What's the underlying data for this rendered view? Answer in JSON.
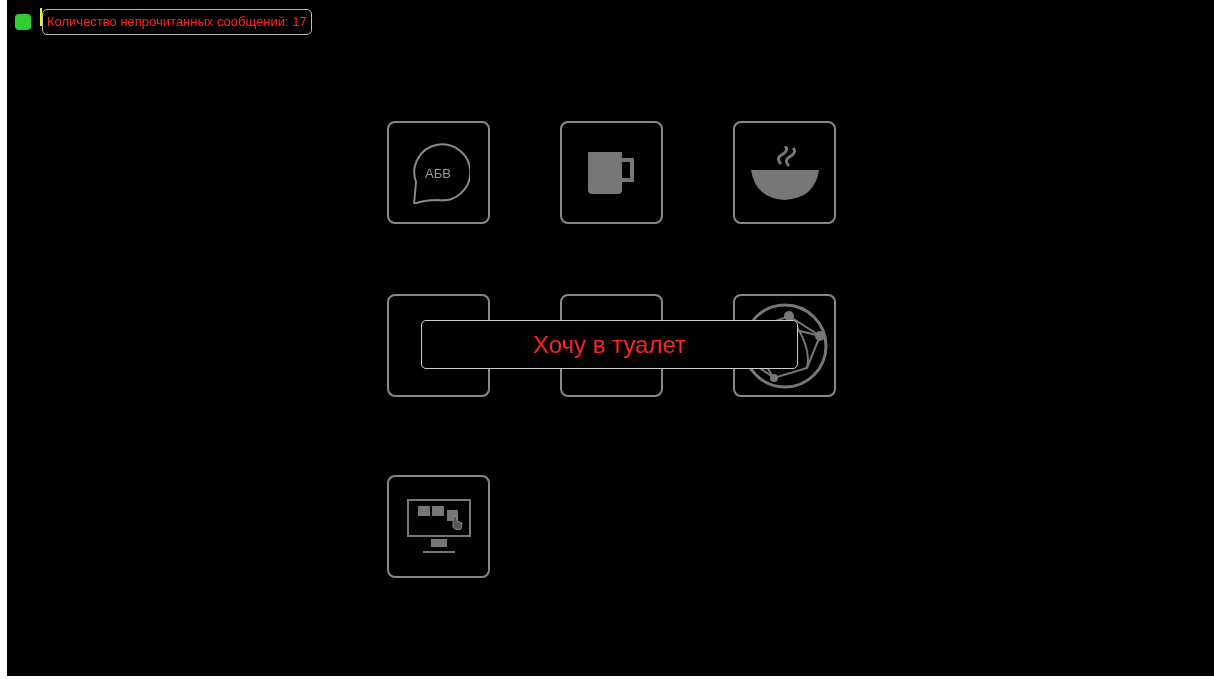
{
  "status": {
    "connected": true,
    "unread_label": "Количество непрочитанных сообщений: 17"
  },
  "tiles": [
    {
      "kind": "speech",
      "text": "АБВ"
    },
    {
      "kind": "mug"
    },
    {
      "kind": "bowl"
    },
    {
      "kind": "covered"
    },
    {
      "kind": "covered"
    },
    {
      "kind": "globe"
    },
    {
      "kind": "monitor"
    }
  ],
  "toast": {
    "message": "Хочу в туалет"
  }
}
